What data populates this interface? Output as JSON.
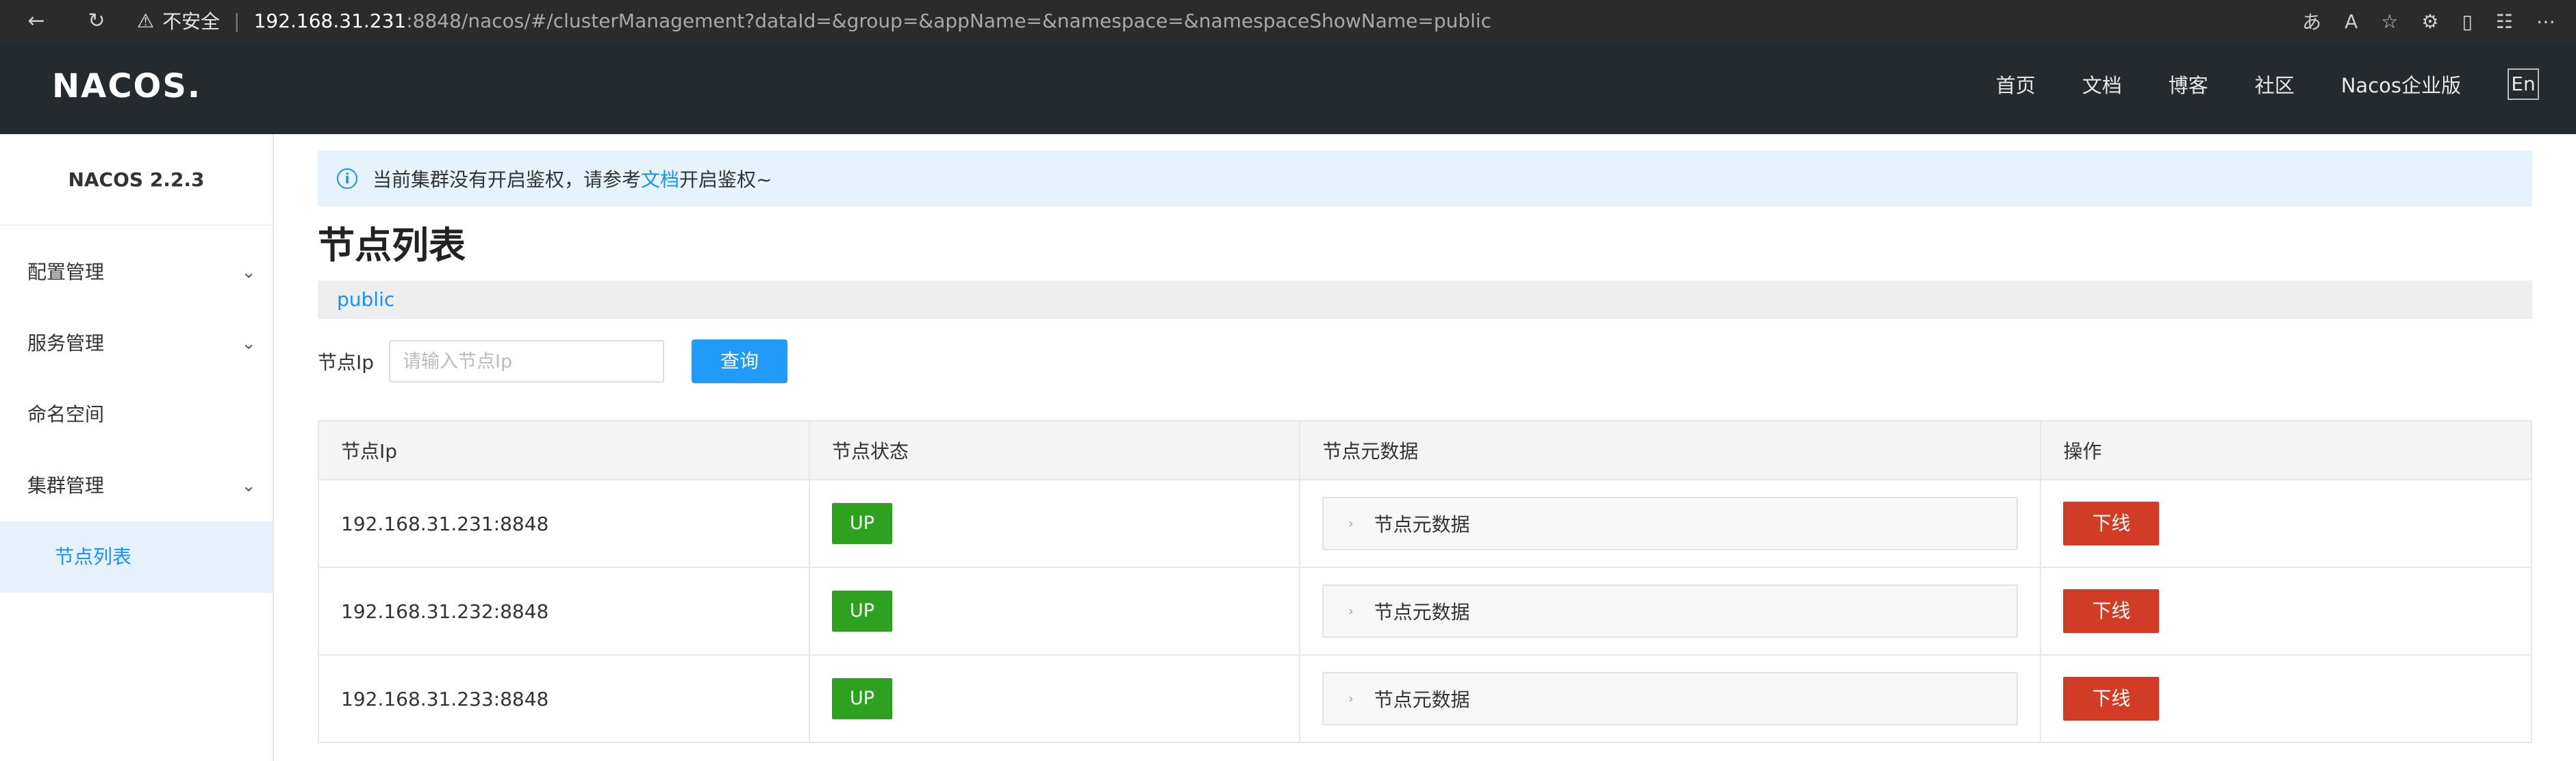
{
  "browser": {
    "security_label": "不安全",
    "url_host": "192.168.31.231",
    "url_rest": ":8848/nacos/#/clusterManagement?dataId=&group=&appName=&namespace=&namespaceShowName=public"
  },
  "header": {
    "logo": "NACOS.",
    "nav": [
      "首页",
      "文档",
      "博客",
      "社区",
      "Nacos企业版"
    ],
    "lang": "En"
  },
  "sidebar": {
    "version": "NACOS 2.2.3",
    "items": [
      {
        "label": "配置管理"
      },
      {
        "label": "服务管理"
      },
      {
        "label": "命名空间"
      },
      {
        "label": "集群管理"
      }
    ],
    "active_sub": "节点列表"
  },
  "notice": {
    "text_before": "当前集群没有开启鉴权，请参考",
    "link": "文档",
    "text_after": "开启鉴权~"
  },
  "page": {
    "title": "节点列表",
    "namespace": "public"
  },
  "search": {
    "label": "节点Ip",
    "placeholder": "请输入节点Ip",
    "button": "查询"
  },
  "table": {
    "headers": [
      "节点Ip",
      "节点状态",
      "节点元数据",
      "操作"
    ],
    "rows": [
      {
        "ip": "192.168.31.231:8848",
        "status": "UP",
        "meta": "节点元数据",
        "action": "下线"
      },
      {
        "ip": "192.168.31.232:8848",
        "status": "UP",
        "meta": "节点元数据",
        "action": "下线"
      },
      {
        "ip": "192.168.31.233:8848",
        "status": "UP",
        "meta": "节点元数据",
        "action": "下线"
      }
    ]
  },
  "colors": {
    "primary": "#209bfa",
    "status_up": "#2ea121",
    "danger": "#d23c26",
    "header_bg": "#252a2f"
  }
}
